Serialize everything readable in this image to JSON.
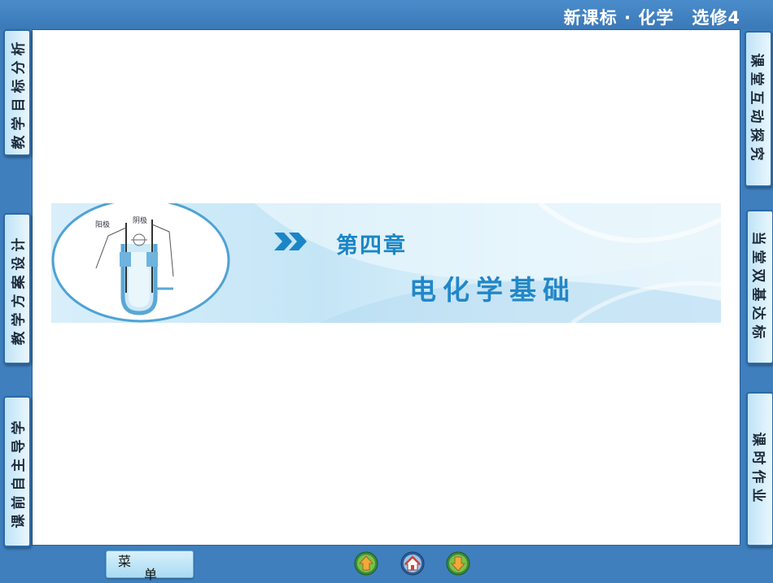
{
  "header": {
    "course_title": "新课标 · 化学　选修4"
  },
  "left_tabs": [
    {
      "label": "教学目标分析"
    },
    {
      "label": "教学方案设计"
    },
    {
      "label": "课前自主导学"
    }
  ],
  "right_tabs": [
    {
      "label": "课堂互动探究"
    },
    {
      "label": "当堂双基达标"
    },
    {
      "label": "课时作业"
    }
  ],
  "banner": {
    "chapter": "第四章",
    "subject": "电化学基础",
    "apparatus_labels": {
      "anode": "阳极",
      "cathode": "阴极"
    }
  },
  "bottom_bar": {
    "menu_char1": "菜",
    "menu_char2": "单",
    "nav_icons": [
      "previous-arrow-icon",
      "home-icon",
      "next-arrow-icon"
    ]
  },
  "colors": {
    "background": "#3f7fbe",
    "tab_border": "#2a6aa8",
    "accent_text": "#1b86c6"
  }
}
